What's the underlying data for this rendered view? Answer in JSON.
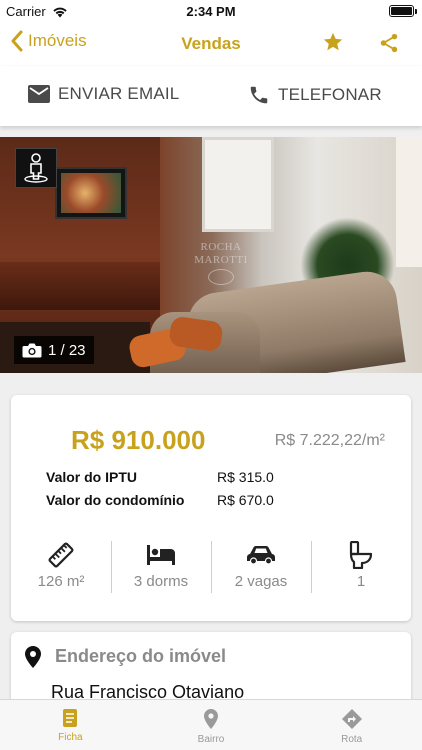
{
  "status_bar": {
    "carrier": "Carrier",
    "time": "2:34 PM"
  },
  "nav": {
    "back_label": "Imóveis",
    "title": "Vendas",
    "star_icon": "star-icon",
    "share_icon": "share-icon",
    "accent": "#c9a21d"
  },
  "actions": {
    "email_label": "ENVIAR EMAIL",
    "phone_label": "TELEFONAR"
  },
  "photo": {
    "counter": "1 / 23",
    "watermark_line1": "ROCHA",
    "watermark_line2": "MAROTTI"
  },
  "price": {
    "main": "R$ 910.000",
    "per_sqm": "R$ 7.222,22/m²",
    "iptu_label": "Valor do IPTU",
    "iptu_value": "R$ 315.0",
    "condo_label": "Valor do condomínio",
    "condo_value": "R$ 670.0"
  },
  "features": [
    {
      "icon": "ruler-icon",
      "label": "126 m²"
    },
    {
      "icon": "bed-icon",
      "label": "3 dorms"
    },
    {
      "icon": "car-icon",
      "label": "2 vagas"
    },
    {
      "icon": "toilet-icon",
      "label": "1"
    }
  ],
  "address": {
    "title": "Endereço do imóvel",
    "street": "Rua Francisco Otaviano"
  },
  "tabs": [
    {
      "label": "Ficha",
      "icon": "document-icon"
    },
    {
      "label": "Bairro",
      "icon": "map-pin-icon"
    },
    {
      "label": "Rota",
      "icon": "directions-icon"
    }
  ]
}
